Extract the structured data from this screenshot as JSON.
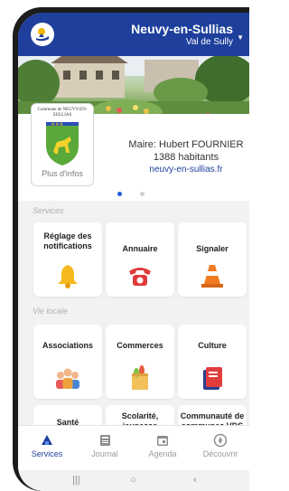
{
  "header": {
    "town": "Neuvy-en-Sullias",
    "subtitle": "Val de Sully",
    "accent": "#1e3f9c"
  },
  "town_card": {
    "crest_caption": "Commune de NEUVY-EN-SULLIAS",
    "more_info": "Plus d'infos",
    "mayor": "Maire: Hubert FOURNIER",
    "inhabitants": "1388 habitants",
    "website": "neuvy-en-sullias.fr"
  },
  "sections": {
    "services": "Services",
    "vie_locale": "Vie locale"
  },
  "services_tiles": [
    {
      "label": "Réglage des notifications",
      "icon": "bell-icon"
    },
    {
      "label": "Annuaire",
      "icon": "telephone-icon"
    },
    {
      "label": "Signaler",
      "icon": "traffic-cone-icon"
    }
  ],
  "vie_locale_tiles": [
    {
      "label": "Associations",
      "icon": "people-icon"
    },
    {
      "label": "Commerces",
      "icon": "shopping-bag-icon"
    },
    {
      "label": "Culture",
      "icon": "book-icon"
    },
    {
      "label": "Santé"
    },
    {
      "label": "Scolarité, jeunesse"
    },
    {
      "label": "Communauté de communes VDS"
    }
  ],
  "bottom_nav": [
    {
      "label": "Services",
      "icon": "services-icon",
      "active": true
    },
    {
      "label": "Journal",
      "icon": "newspaper-icon",
      "active": false
    },
    {
      "label": "Agenda",
      "icon": "calendar-icon",
      "active": false
    },
    {
      "label": "Découvrir",
      "icon": "compass-icon",
      "active": false
    }
  ],
  "carousel": {
    "pages": 2,
    "current": 1
  },
  "system_nav": {
    "recents": "|||",
    "home": "○",
    "back": "‹"
  }
}
